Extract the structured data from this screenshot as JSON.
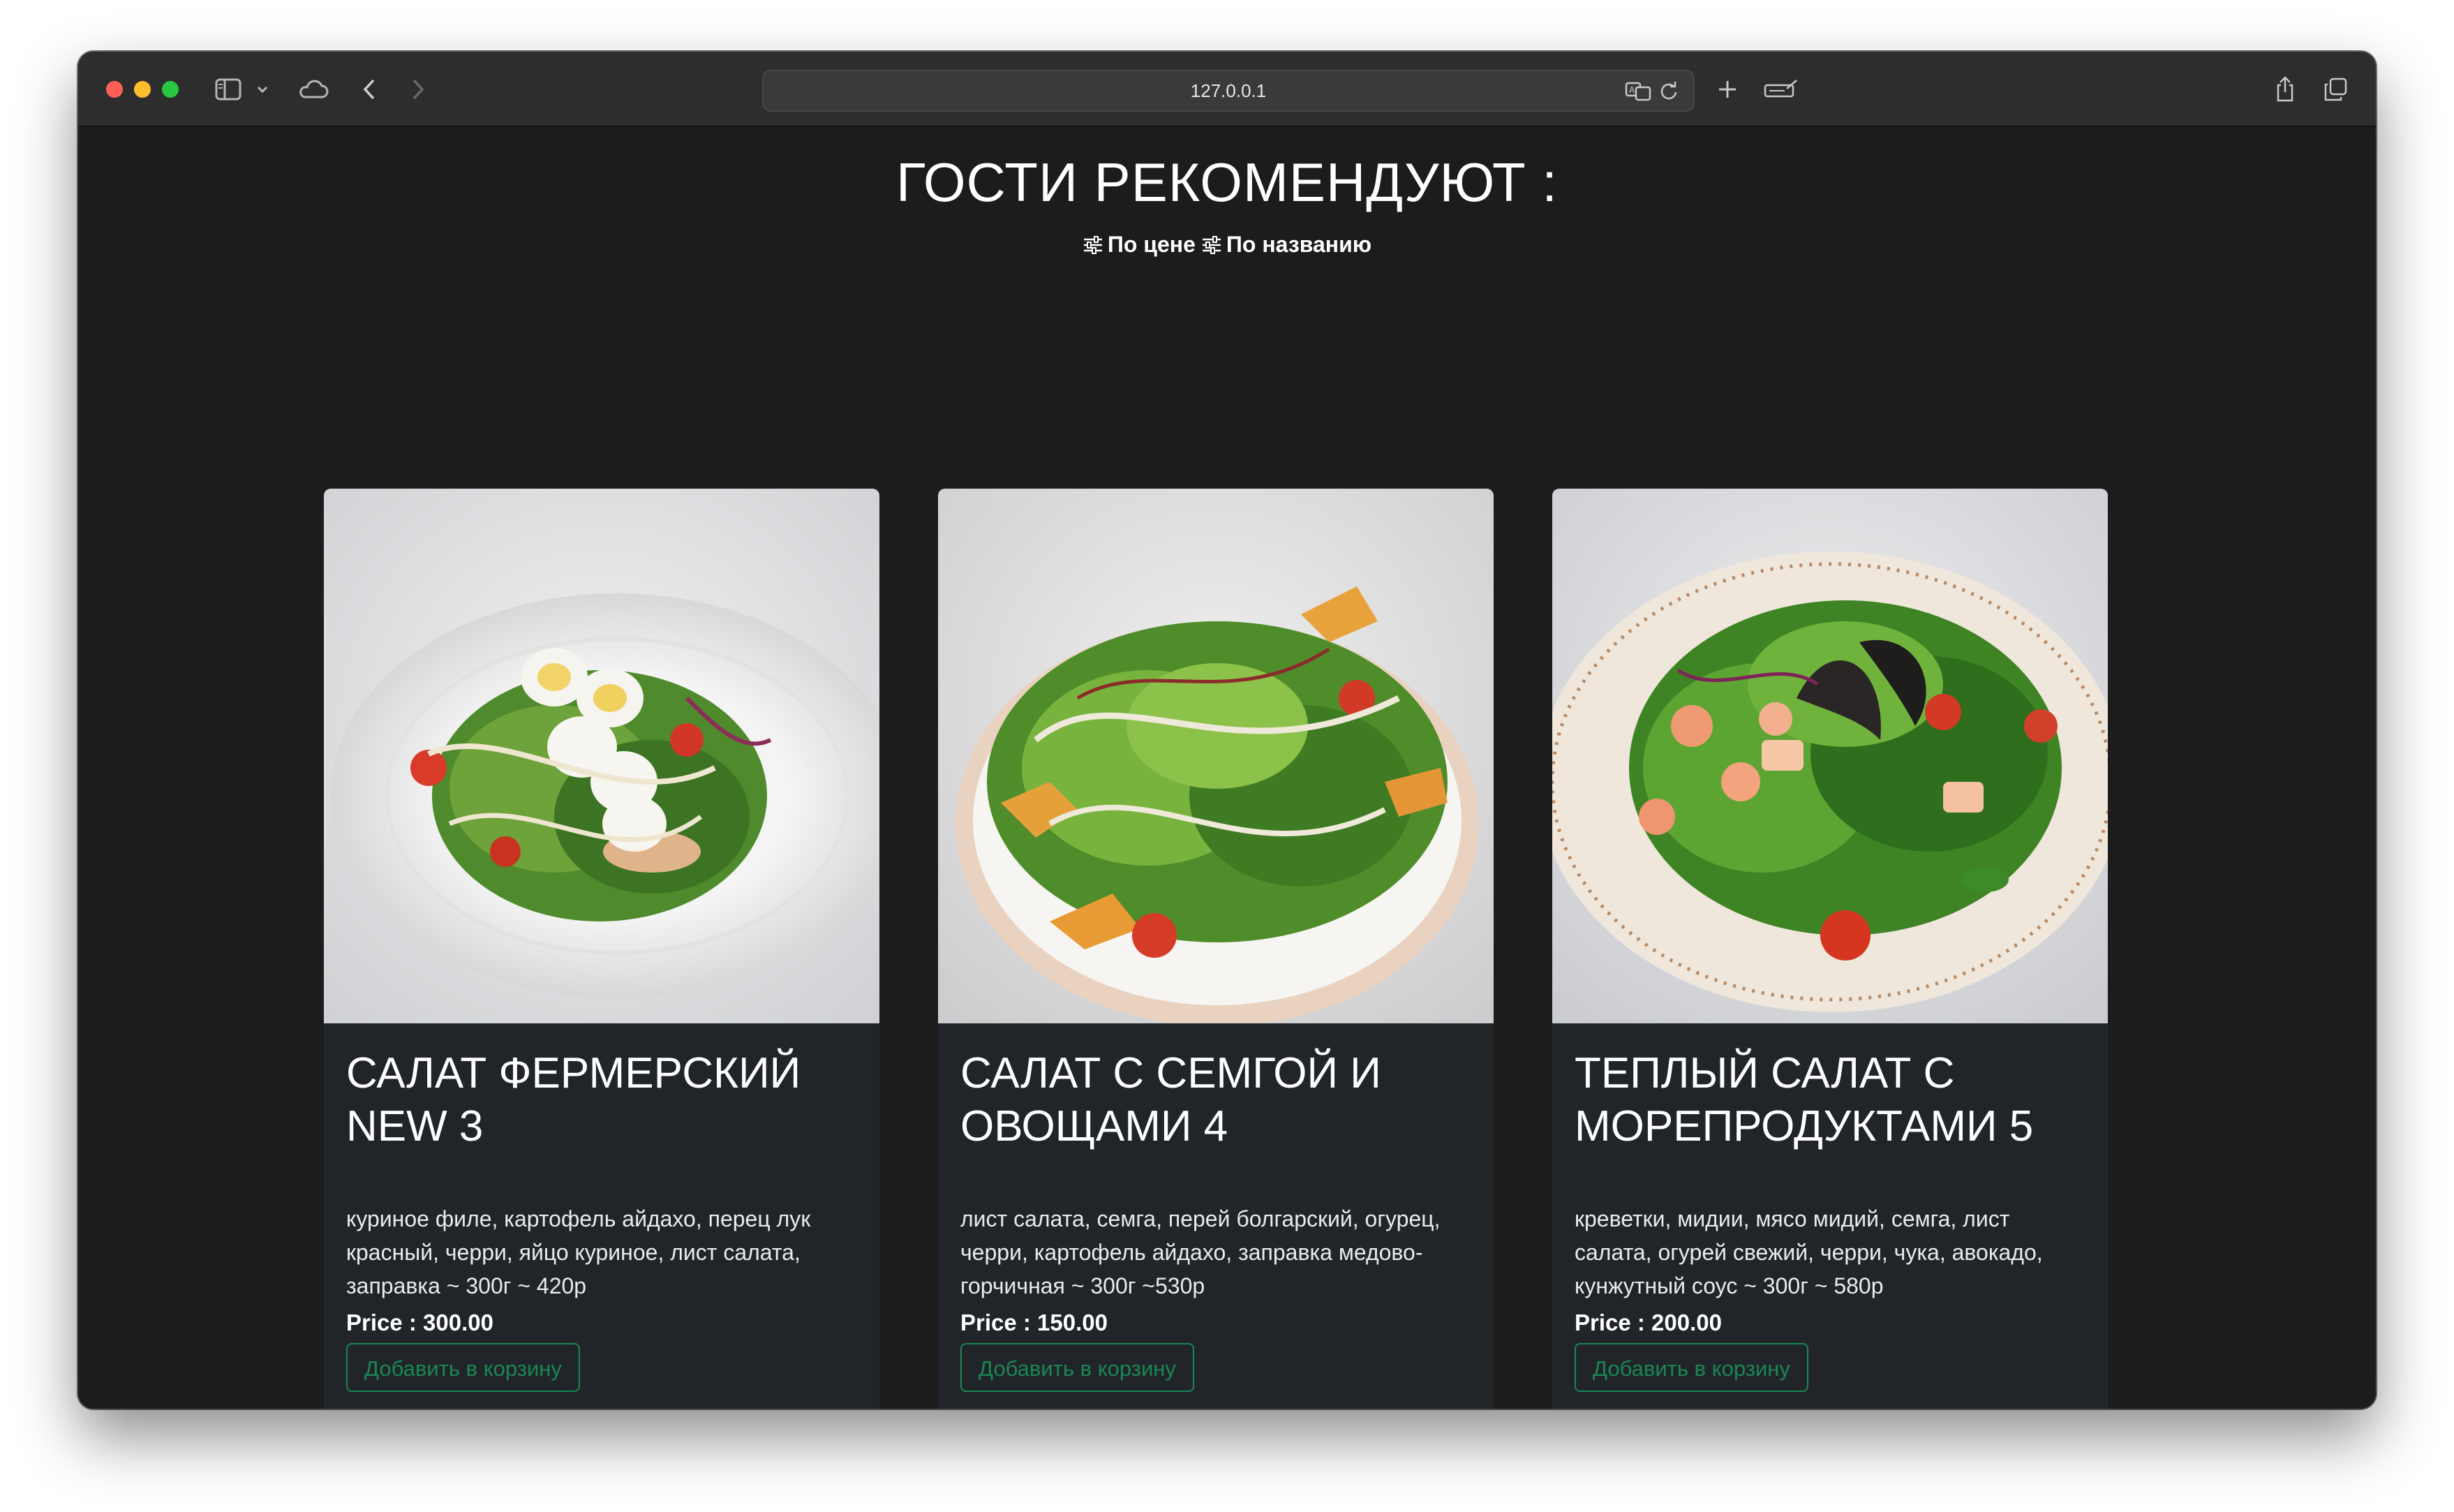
{
  "browser": {
    "url": "127.0.0.1"
  },
  "page": {
    "heading": "ГОСТИ РЕКОМЕНДУЮТ :",
    "sort": [
      {
        "label": "По цене",
        "icon": "sliders-icon"
      },
      {
        "label": "По названию",
        "icon": "sliders-icon"
      }
    ]
  },
  "products": [
    {
      "title": "САЛАТ ФЕРМЕРСКИЙ NEW 3",
      "description": "куриное филе, картофель айдахо, перец лук красный, черри, яйцо куриное, лист салата, заправка ~ 300г ~ 420р",
      "price": "Price : 300.00",
      "button": "Добавить в корзину",
      "image": "salad-with-eggs-photo"
    },
    {
      "title": "САЛАТ С СЕМГОЙ И ОВОЩАМИ 4",
      "description": "лист салата, семга, перей болгарский, огурец, черри, картофель айдахо, заправка медово-горчичная ~ 300г ~530р",
      "price": "Price : 150.00",
      "button": "Добавить в корзину",
      "image": "salad-with-salmon-photo"
    },
    {
      "title": "ТЕПЛЫЙ САЛАТ С МОРЕПРОДУКТАМИ 5",
      "description": "креветки, мидии, мясо мидий, семга, лист салата, огурей свежий, черри, чука, авокадо, кунжутный соус ~ 300г ~ 580р",
      "price": "Price : 200.00",
      "button": "Добавить в корзину",
      "image": "seafood-salad-photo"
    }
  ],
  "colors": {
    "page_bg": "#1c1c1c",
    "card_bg": "#212529",
    "accent_green": "#198754"
  }
}
